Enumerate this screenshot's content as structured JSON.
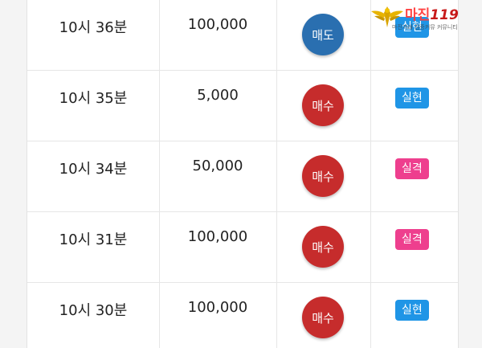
{
  "watermark": {
    "title": "마진",
    "title_suffix": "119",
    "subtitle": "마진거래 검증커뮤 커뮤니티"
  },
  "rows": [
    {
      "time": "10시 36분",
      "amount": "100,000",
      "order": "매도",
      "order_type": "sell",
      "status": "실현",
      "status_type": "gain"
    },
    {
      "time": "10시 35분",
      "amount": "5,000",
      "order": "매수",
      "order_type": "buy",
      "status": "실현",
      "status_type": "gain"
    },
    {
      "time": "10시 34분",
      "amount": "50,000",
      "order": "매수",
      "order_type": "buy",
      "status": "실격",
      "status_type": "loss"
    },
    {
      "time": "10시 31분",
      "amount": "100,000",
      "order": "매수",
      "order_type": "buy",
      "status": "실격",
      "status_type": "loss"
    },
    {
      "time": "10시 30분",
      "amount": "100,000",
      "order": "매수",
      "order_type": "buy",
      "status": "실현",
      "status_type": "gain"
    }
  ],
  "colors": {
    "sell": "#2a6fb0",
    "buy": "#c62c2c",
    "gain": "#1f95e6",
    "loss": "#ee3f8e"
  }
}
